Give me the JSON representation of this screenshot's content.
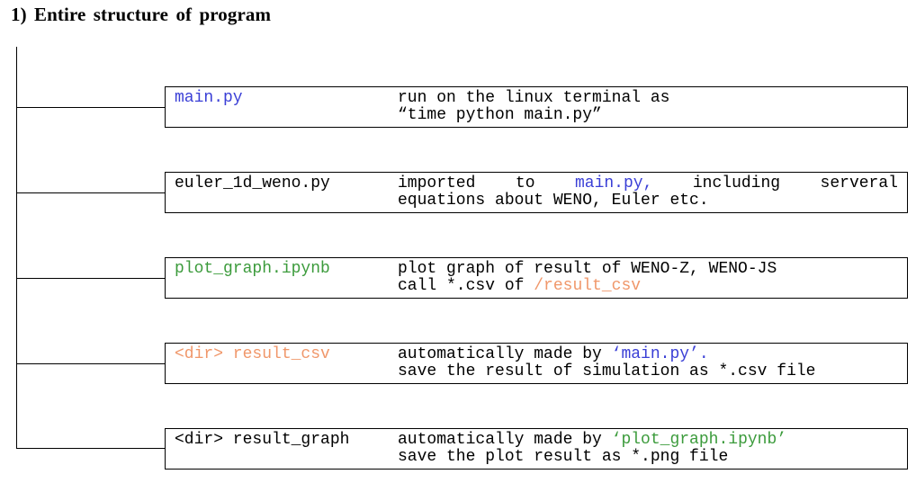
{
  "title": "1) Entire structure of program",
  "colors": {
    "blue": "#3a3fd6",
    "green": "#3c9b3c",
    "orange": "#f0976a"
  },
  "items": [
    {
      "name": "main.py",
      "line1": "run on the linux terminal as",
      "line2": "“time python main.py”"
    },
    {
      "name": "euler_1d_weno.py",
      "line1_words": [
        "imported",
        "to",
        "main.py,",
        "including",
        "serveral"
      ],
      "line2": "equations about WENO, Euler etc."
    },
    {
      "name": "plot_graph.ipynb",
      "line1": "plot graph of result of WENO-Z, WENO-JS",
      "line2_prefix": "call *.csv of ",
      "line2_path": "/result_csv"
    },
    {
      "name": "<dir> result_csv",
      "line1_prefix": "automatically made by ",
      "line1_ref": "‘main.py’.",
      "line2": "save the result of simulation as *.csv file"
    },
    {
      "name": "<dir> result_graph",
      "line1_prefix": "automatically made by ",
      "line1_ref": "‘plot_graph.ipynb’",
      "line2": "save the plot result as *.png file"
    }
  ]
}
